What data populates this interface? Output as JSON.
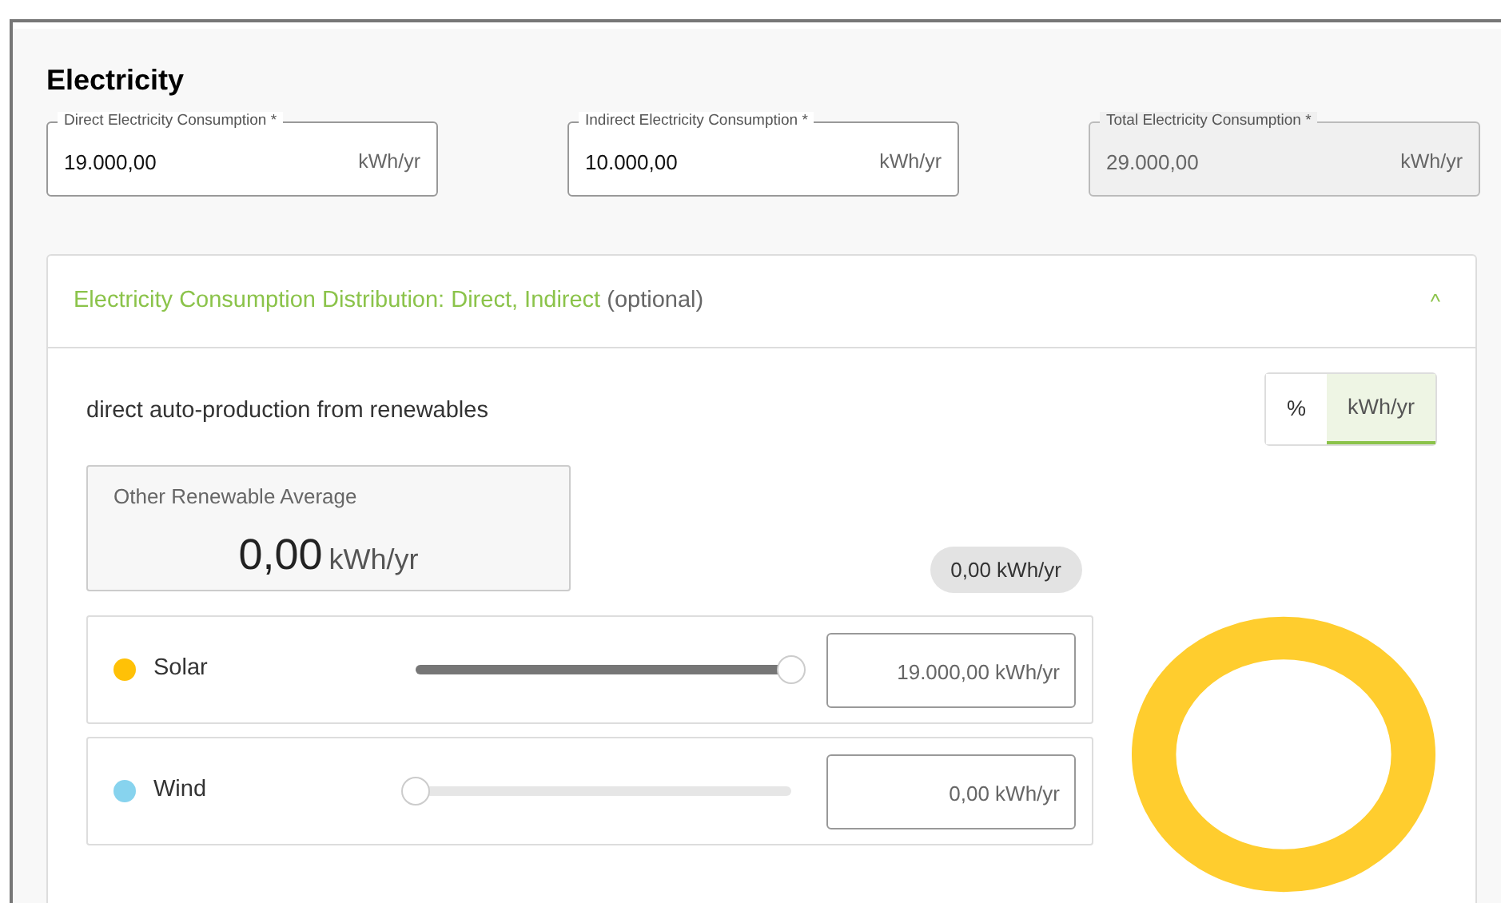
{
  "section": {
    "title": "Electricity"
  },
  "fields": [
    {
      "label": "Direct Electricity Consumption *",
      "value": "19.000,00",
      "unit": "kWh/yr",
      "disabled": false
    },
    {
      "label": "Indirect Electricity Consumption *",
      "value": "10.000,00",
      "unit": "kWh/yr",
      "disabled": false
    },
    {
      "label": "Total Electricity Consumption *",
      "value": "29.000,00",
      "unit": "kWh/yr",
      "disabled": true
    }
  ],
  "accordion": {
    "title": "Electricity Consumption Distribution: Direct, Indirect",
    "note": "(optional)",
    "expanded": true,
    "collapse_icon": "^",
    "subtitle": "direct auto-production from renewables",
    "unit_toggle": [
      {
        "label": "%",
        "selected": false
      },
      {
        "label": "kWh/yr",
        "selected": true
      }
    ],
    "average": {
      "label": "Other Renewable Average",
      "value": "0,00",
      "unit": "kWh/yr"
    },
    "remaining": "0,00 kWh/yr",
    "sources": [
      {
        "name": "Solar",
        "color": "#ffc107",
        "level": 1,
        "value": "19.000,00 kWh/yr"
      },
      {
        "name": "Wind",
        "color": "#87d3ee",
        "level": 0,
        "value": "0,00 kWh/yr"
      }
    ]
  }
}
